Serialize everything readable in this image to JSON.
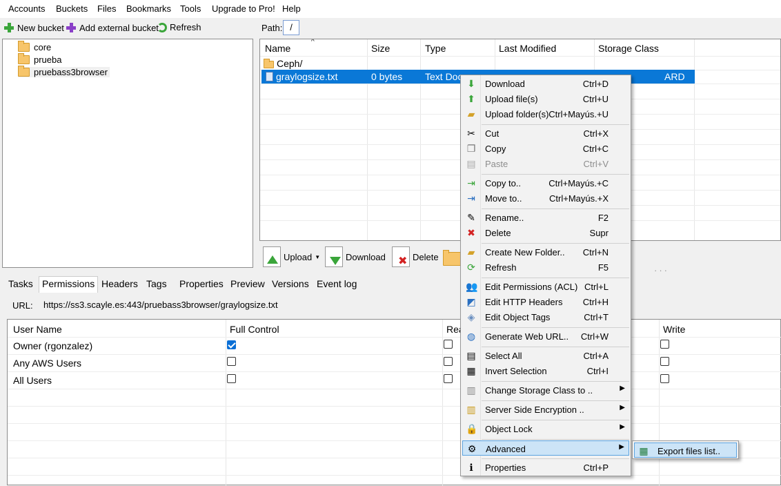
{
  "menubar": [
    "Accounts",
    "Buckets",
    "Files",
    "Bookmarks",
    "Tools",
    "Upgrade to Pro!",
    "Help"
  ],
  "toolbar": {
    "new_bucket": "New bucket",
    "add_external": "Add external bucket",
    "refresh": "Refresh"
  },
  "tree": [
    "core",
    "prueba",
    "pruebass3browser"
  ],
  "path": {
    "label": "Path:",
    "value": "/"
  },
  "filelist": {
    "columns": [
      "Name",
      "Size",
      "Type",
      "Last Modified",
      "Storage Class"
    ],
    "rows": [
      {
        "name": "Ceph/",
        "size": "",
        "type": "",
        "modified": "",
        "storage": ""
      },
      {
        "name": "graylogsize.txt",
        "size": "0 bytes",
        "type": "Text Doc",
        "modified": "",
        "storage": "ARD"
      }
    ]
  },
  "actions": {
    "upload": "Upload",
    "download": "Download",
    "delete": "Delete"
  },
  "tabs": [
    "Tasks",
    "Permissions",
    "Headers",
    "Tags",
    "Properties",
    "Preview",
    "Versions",
    "Event log"
  ],
  "url": {
    "label": "URL:",
    "value": "https://ss3.scayle.es:443/pruebass3browser/graylogsize.txt"
  },
  "permissions": {
    "columns": [
      "User Name",
      "Full Control",
      "Rea",
      "Write"
    ],
    "rows": [
      {
        "user": "Owner (rgonzalez)",
        "full": true,
        "read": false,
        "write": false
      },
      {
        "user": "Any AWS Users",
        "full": false,
        "read": false,
        "write": false
      },
      {
        "user": "All Users",
        "full": false,
        "read": false,
        "write": false
      }
    ]
  },
  "context_menu": [
    {
      "label": "Download",
      "shortcut": "Ctrl+D",
      "icon": "download-icon"
    },
    {
      "label": "Upload file(s)",
      "shortcut": "Ctrl+U",
      "icon": "upload-icon"
    },
    {
      "label": "Upload folder(s)",
      "shortcut": "Ctrl+Mayús.+U",
      "icon": "upload-folder-icon"
    },
    {
      "label": "Cut",
      "shortcut": "Ctrl+X",
      "icon": "scissors-icon"
    },
    {
      "label": "Copy",
      "shortcut": "Ctrl+C",
      "icon": "copy-icon"
    },
    {
      "label": "Paste",
      "shortcut": "Ctrl+V",
      "icon": "paste-icon"
    },
    {
      "label": "Copy to..",
      "shortcut": "Ctrl+Mayús.+C",
      "icon": "copy-to-icon"
    },
    {
      "label": "Move to..",
      "shortcut": "Ctrl+Mayús.+X",
      "icon": "move-to-icon"
    },
    {
      "label": "Rename..",
      "shortcut": "F2",
      "icon": "pencil-icon"
    },
    {
      "label": "Delete",
      "shortcut": "Supr",
      "icon": "delete-icon"
    },
    {
      "label": "Create New Folder..",
      "shortcut": "Ctrl+N",
      "icon": "new-folder-icon"
    },
    {
      "label": "Refresh",
      "shortcut": "F5",
      "icon": "refresh-icon"
    },
    {
      "label": "Edit Permissions (ACL)",
      "shortcut": "Ctrl+L",
      "icon": "users-icon"
    },
    {
      "label": "Edit HTTP Headers",
      "shortcut": "Ctrl+H",
      "icon": "headers-icon"
    },
    {
      "label": "Edit Object Tags",
      "shortcut": "Ctrl+T",
      "icon": "tag-icon"
    },
    {
      "label": "Generate Web URL..",
      "shortcut": "Ctrl+W",
      "icon": "web-url-icon"
    },
    {
      "label": "Select All",
      "shortcut": "Ctrl+A",
      "icon": "select-all-icon"
    },
    {
      "label": "Invert Selection",
      "shortcut": "Ctrl+I",
      "icon": "invert-selection-icon"
    },
    {
      "label": "Change Storage Class to ..",
      "shortcut": "",
      "icon": "storage-class-icon"
    },
    {
      "label": "Server Side Encryption ..",
      "shortcut": "",
      "icon": "encryption-icon"
    },
    {
      "label": "Object Lock",
      "shortcut": "",
      "icon": "lock-icon"
    },
    {
      "label": "Advanced",
      "shortcut": "",
      "icon": "advanced-icon"
    },
    {
      "label": "Properties",
      "shortcut": "Ctrl+P",
      "icon": "info-icon"
    }
  ],
  "submenu": {
    "label": "Export files list..",
    "icon": "excel-icon"
  }
}
